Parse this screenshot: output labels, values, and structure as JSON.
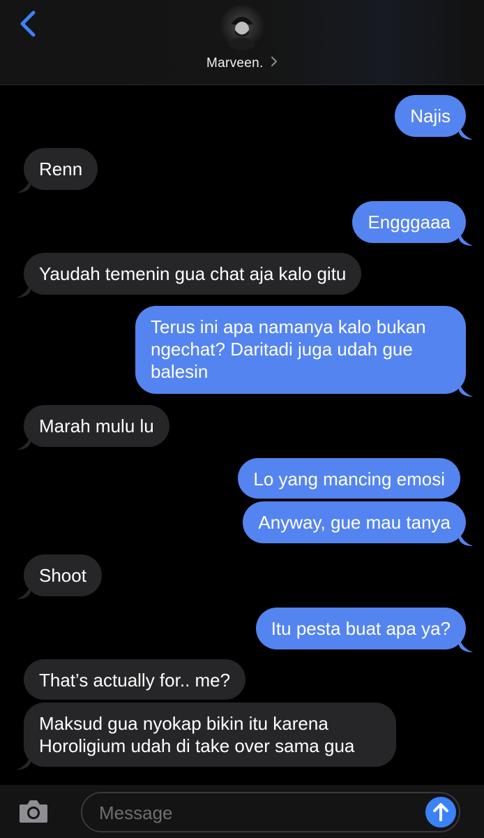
{
  "header": {
    "contact_name": "Marveen.",
    "back_icon": "chevron-left-icon",
    "chevron_icon": "chevron-right-icon",
    "accent_color": "#3b82f6"
  },
  "messages": [
    {
      "direction": "out",
      "text": "Najis"
    },
    {
      "direction": "in",
      "text": "Renn"
    },
    {
      "direction": "out",
      "text": "Engggaaa"
    },
    {
      "direction": "in",
      "text": "Yaudah temenin gua chat aja kalo gitu"
    },
    {
      "direction": "out",
      "text": "Terus ini apa namanya kalo bukan\nngechat? Daritadi juga udah gue\nbalesin"
    },
    {
      "direction": "in",
      "text": "Marah mulu lu"
    },
    {
      "direction": "out",
      "text": "Lo yang mancing emosi"
    },
    {
      "direction": "out",
      "text": "Anyway, gue mau tanya"
    },
    {
      "direction": "in",
      "text": "Shoot"
    },
    {
      "direction": "out",
      "text": "Itu pesta buat apa ya?"
    },
    {
      "direction": "in",
      "text": "That’s actually for.. me?"
    },
    {
      "direction": "in",
      "text": "Maksud gua nyokap bikin itu karena\nHoroligium udah di take over sama gua"
    }
  ],
  "composer": {
    "placeholder": "Message",
    "camera_icon": "camera-icon",
    "send_icon": "arrow-up-icon"
  },
  "colors": {
    "outgoing_bubble": "#5484ef",
    "incoming_bubble": "#262628",
    "background": "#000000"
  }
}
